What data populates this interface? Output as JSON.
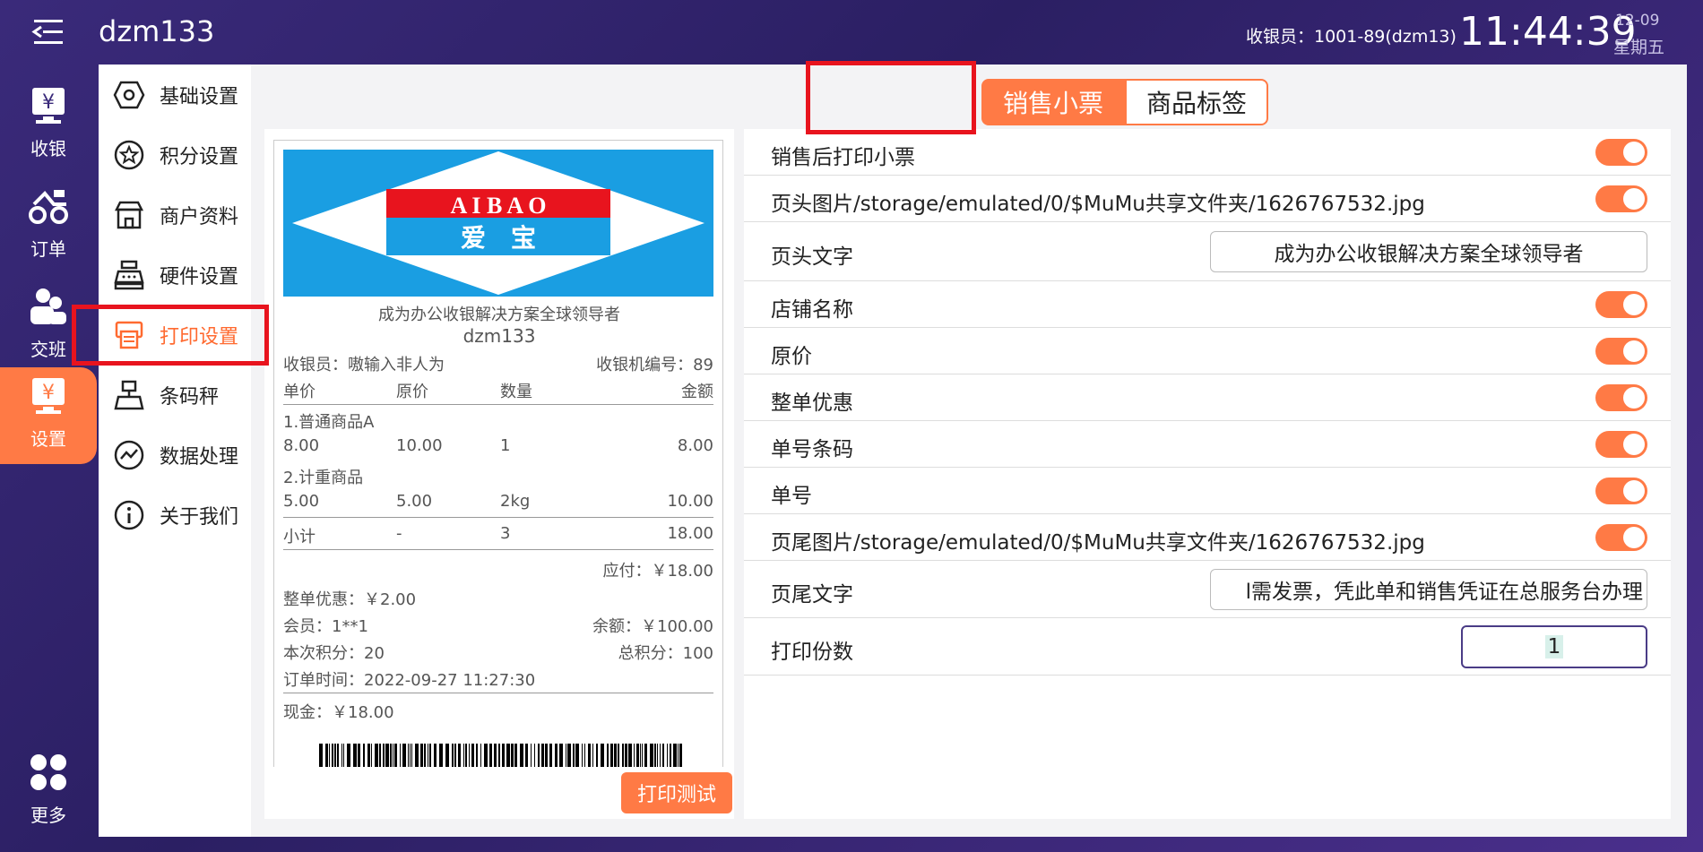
{
  "header": {
    "app_title": "dzm133",
    "cashier": "收银员：1001-89(dzm13)",
    "time": "11:44:39",
    "date": "12-09",
    "weekday": "星期五"
  },
  "nav": {
    "items": [
      {
        "label": "收银",
        "icon": "cash-register-icon"
      },
      {
        "label": "订单",
        "icon": "order-icon"
      },
      {
        "label": "交班",
        "icon": "shift-icon"
      },
      {
        "label": "设置",
        "icon": "settings-icon"
      },
      {
        "label": "更多",
        "icon": "more-icon"
      }
    ],
    "active": "设置"
  },
  "settings_menu": {
    "items": [
      {
        "label": "基础设置",
        "icon": "hexagon-settings-icon"
      },
      {
        "label": "积分设置",
        "icon": "star-icon"
      },
      {
        "label": "商户资料",
        "icon": "store-icon"
      },
      {
        "label": "硬件设置",
        "icon": "cash-register-hardware-icon"
      },
      {
        "label": "打印设置",
        "icon": "printer-icon"
      },
      {
        "label": "条码秤",
        "icon": "scale-icon"
      },
      {
        "label": "数据处理",
        "icon": "chart-line-icon"
      },
      {
        "label": "关于我们",
        "icon": "info-icon"
      }
    ],
    "active": "打印设置"
  },
  "tabs": {
    "receipt": "销售小票",
    "label": "商品标签",
    "active": "销售小票"
  },
  "receipt": {
    "logo_en": "A I B A O",
    "logo_cn": "爱　宝",
    "slogan": "成为办公收银解决方案全球领导者",
    "store": "dzm133",
    "cashier": "收银员：嗷输入非人为",
    "terminal": "收银机编号：89",
    "headers": [
      "单价",
      "原价",
      "数量",
      "金额"
    ],
    "items": [
      {
        "name": "1.普通商品A",
        "price": "8.00",
        "orig": "10.00",
        "qty": "1",
        "amount": "8.00"
      },
      {
        "name": "2.计重商品",
        "price": "5.00",
        "orig": "5.00",
        "qty": "2kg",
        "amount": "10.00"
      }
    ],
    "subtotal": {
      "label": "小计",
      "orig": "-",
      "qty": "3",
      "amount": "18.00"
    },
    "payable": "应付：￥18.00",
    "discount": "整单优惠：￥2.00",
    "member": "会员：1**1",
    "balance": "余额：￥100.00",
    "points": "本次积分：20",
    "total_points": "总积分：100",
    "order_time": "订单时间：2022-09-27 11:27:30",
    "cash": "现金：￥18.00"
  },
  "print_test_label": "打印测试",
  "settings": {
    "print_after_sale": "销售后打印小票",
    "header_image": "页头图片/storage/emulated/0/$MuMu共享文件夹/1626767532.jpg",
    "header_text_label": "页头文字",
    "header_text_value": "成为办公收银解决方案全球领导者",
    "store_name": "店铺名称",
    "original_price": "原价",
    "order_discount": "整单优惠",
    "order_barcode": "单号条码",
    "order_no": "单号",
    "footer_image": "页尾图片/storage/emulated/0/$MuMu共享文件夹/1626767532.jpg",
    "footer_text_label": "页尾文字",
    "footer_text_value": "l需发票，凭此单和销售凭证在总服务台办理",
    "copies_label": "打印份数",
    "copies_value": "1"
  },
  "colors": {
    "accent": "#ff7a45",
    "highlight": "#e8141e",
    "background": "#2b1f63"
  }
}
